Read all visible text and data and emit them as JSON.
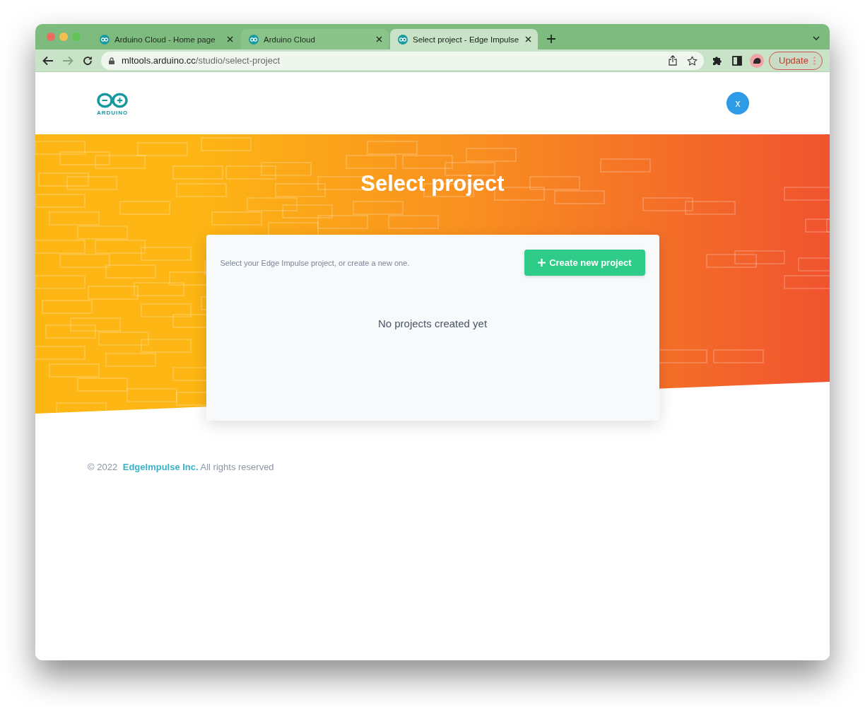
{
  "browser": {
    "tabs": [
      {
        "title": "Arduino Cloud - Home page",
        "selected": false,
        "hovered": false
      },
      {
        "title": "Arduino Cloud",
        "selected": false,
        "hovered": true
      },
      {
        "title": "Select project - Edge Impulse",
        "selected": true,
        "hovered": false
      }
    ],
    "navigation": {
      "back": {
        "disabled": false
      },
      "forward": {
        "disabled": true
      }
    },
    "address": {
      "host": "mltools.arduino.cc",
      "path": "/studio/select-project"
    },
    "update_button": "Update"
  },
  "page": {
    "header": {
      "logo_text": "ARDUINO",
      "avatar_letter": "x"
    },
    "hero": {
      "title": "Select project"
    },
    "card": {
      "intro": "Select your Edge Impulse project, or create a new one.",
      "create_button": "Create new project",
      "empty_message": "No projects created yet"
    },
    "footer": {
      "copyright": "© 2022",
      "company_link": "EdgeImpulse Inc.",
      "rights": "All rights reserved"
    }
  }
}
